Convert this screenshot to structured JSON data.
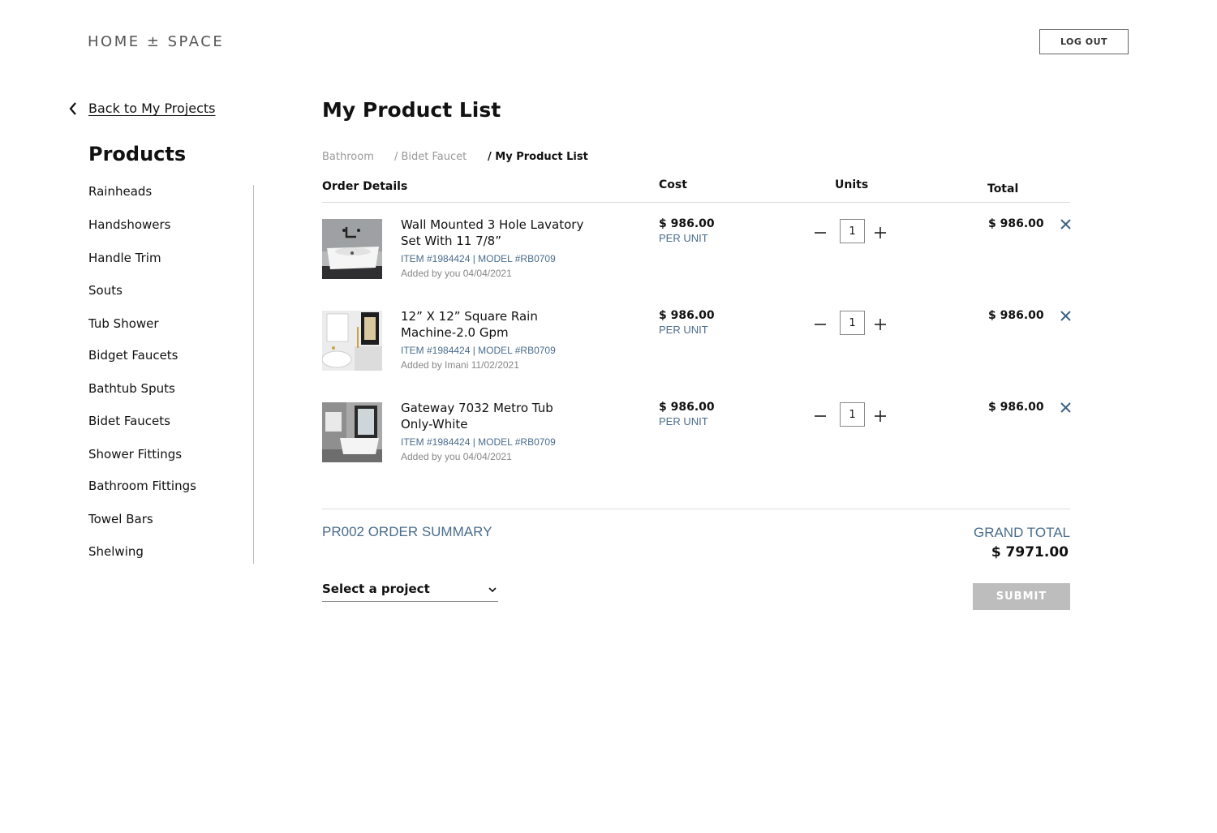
{
  "header": {
    "logo": "HOME ± SPACE",
    "logout_label": "LOG OUT"
  },
  "sidebar": {
    "back_label": "Back to My Projects",
    "title": "Products",
    "items": [
      {
        "label": "Rainheads"
      },
      {
        "label": "Handshowers"
      },
      {
        "label": "Handle Trim"
      },
      {
        "label": "Souts"
      },
      {
        "label": "Tub Shower"
      },
      {
        "label": "Bidget Faucets"
      },
      {
        "label": "Bathtub Sputs"
      },
      {
        "label": "Bidet Faucets"
      },
      {
        "label": "Shower Fittings"
      },
      {
        "label": "Bathroom Fittings"
      },
      {
        "label": "Towel Bars"
      },
      {
        "label": "Shelwing"
      }
    ]
  },
  "main": {
    "title": "My Product List",
    "breadcrumb": [
      {
        "label": "Bathroom"
      },
      {
        "label": "/ Bidet Faucet"
      },
      {
        "label": "/ My Product List"
      }
    ],
    "columns": {
      "details": "Order Details",
      "cost": "Cost",
      "units": "Units",
      "total": "Total"
    },
    "items": [
      {
        "name": "Wall Mounted 3 Hole Lavatory Set With 11 7/8”",
        "meta": "ITEM #1984424 | MODEL #RB0709",
        "added": "Added by you 04/04/2021",
        "price": "$ 986.00",
        "per_unit": "PER UNIT",
        "qty": "1",
        "total": "$ 986.00"
      },
      {
        "name": "12” X 12” Square Rain Machine-2.0 Gpm",
        "meta": "ITEM #1984424 | MODEL #RB0709",
        "added": "Added by Imani 11/02/2021",
        "price": "$ 986.00",
        "per_unit": "PER UNIT",
        "qty": "1",
        "total": "$ 986.00"
      },
      {
        "name": "Gateway 7032 Metro Tub Only-White",
        "meta": "ITEM #1984424 | MODEL #RB0709",
        "added": "Added by you 04/04/2021",
        "price": "$ 986.00",
        "per_unit": "PER UNIT",
        "qty": "1",
        "total": "$ 986.00"
      }
    ],
    "summary": {
      "label": "PR002 ORDER SUMMARY",
      "grand_total_label": "GRAND TOTAL",
      "grand_total_value": "$ 7971.00",
      "select_label": "Select a project",
      "submit_label": "SUBMIT"
    }
  },
  "colors": {
    "accent_blue": "#4a6c8c",
    "muted_gray": "#999999",
    "submit_disabled": "#bdbdbd"
  }
}
